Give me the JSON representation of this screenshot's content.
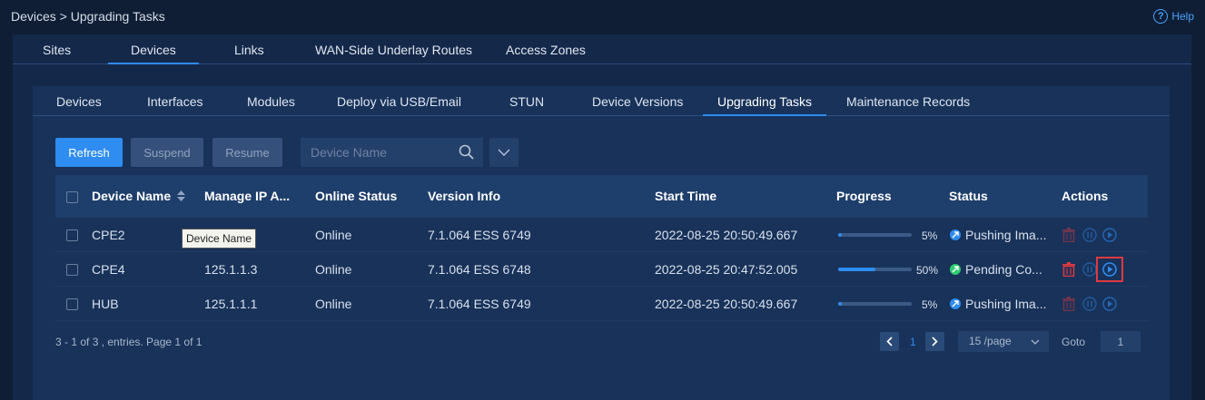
{
  "breadcrumb": "Devices > Upgrading Tasks",
  "help_label": "Help",
  "main_tabs": [
    "Sites",
    "Devices",
    "Links",
    "WAN-Side Underlay Routes",
    "Access Zones"
  ],
  "sub_tabs": [
    "Devices",
    "Interfaces",
    "Modules",
    "Deploy via USB/Email",
    "STUN",
    "Device Versions",
    "Upgrading Tasks",
    "Maintenance Records"
  ],
  "toolbar": {
    "refresh_label": "Refresh",
    "suspend_label": "Suspend",
    "resume_label": "Resume",
    "search_placeholder": "Device Name"
  },
  "table": {
    "headers": [
      "Device Name",
      "Manage IP A...",
      "Online Status",
      "Version Info",
      "Start Time",
      "Progress",
      "Status",
      "Actions"
    ],
    "rows": [
      {
        "name": "CPE2",
        "ip": "",
        "online": "Online",
        "version": "7.1.064 ESS 6749",
        "start": "2022-08-25 20:50:49.667",
        "progress": 5,
        "progress_label": "5%",
        "status": "Pushing Ima..."
      },
      {
        "name": "CPE4",
        "ip": "125.1.1.3",
        "online": "Online",
        "version": "7.1.064 ESS 6748",
        "start": "2022-08-25 20:47:52.005",
        "progress": 50,
        "progress_label": "50%",
        "status": "Pending Co..."
      },
      {
        "name": "HUB",
        "ip": "125.1.1.1",
        "online": "Online",
        "version": "7.1.064 ESS 6749",
        "start": "2022-08-25 20:50:49.667",
        "progress": 5,
        "progress_label": "5%",
        "status": "Pushing Ima..."
      }
    ]
  },
  "tooltip": "Device Name",
  "footer": {
    "info": "3 - 1 of 3 , entries. Page 1 of 1",
    "current_page": "1",
    "page_size": "15 /page",
    "goto_label": "Goto",
    "goto_value": "1"
  },
  "colors": {
    "accent": "#2f8cf0",
    "status_pushing": "#2f8cf0",
    "status_pending": "#2ecc71",
    "delete_icon": "#e0393e",
    "highlight_box": "#e0393e"
  }
}
